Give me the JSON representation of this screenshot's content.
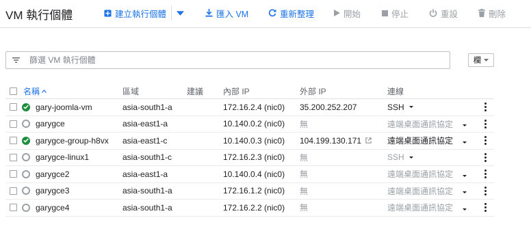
{
  "header": {
    "title": "VM 執行個體",
    "create_label": "建立執行個體",
    "import_label": "匯入 VM",
    "refresh_label": "重新整理",
    "start_label": "開始",
    "stop_label": "停止",
    "reset_label": "重設",
    "delete_label": "刪除"
  },
  "filter": {
    "placeholder": "篩選 VM 執行個體"
  },
  "columns_button": {
    "label": "欄"
  },
  "table": {
    "headers": {
      "name": "名稱",
      "zone": "區域",
      "recommendation": "建議",
      "internal_ip": "內部 IP",
      "external_ip": "外部 IP",
      "connect": "連線"
    },
    "rows": [
      {
        "name": "gary-joomla-vm",
        "status": "running",
        "zone": "asia-south1-a",
        "internal_ip": "172.16.2.4 (nic0)",
        "external_ip": "35.200.252.207",
        "connect": "SSH"
      },
      {
        "name": "garygce",
        "status": "stopped",
        "zone": "asia-east1-a",
        "internal_ip": "10.140.0.2 (nic0)",
        "external_ip": "無",
        "connect": "遠端桌面通訊協定"
      },
      {
        "name": "garygce-group-h8vx",
        "status": "running",
        "zone": "asia-east1-c",
        "internal_ip": "10.140.0.3 (nic0)",
        "external_ip": "104.199.130.171",
        "connect": "遠端桌面通訊協定"
      },
      {
        "name": "garygce-linux1",
        "status": "stopped",
        "zone": "asia-south1-c",
        "internal_ip": "172.16.2.3 (nic0)",
        "external_ip": "無",
        "connect": "SSH"
      },
      {
        "name": "garygce2",
        "status": "stopped",
        "zone": "asia-east1-a",
        "internal_ip": "10.140.0.4 (nic0)",
        "external_ip": "無",
        "connect": "遠端桌面通訊協定"
      },
      {
        "name": "garygce3",
        "status": "stopped",
        "zone": "asia-south1-a",
        "internal_ip": "172.16.1.2 (nic0)",
        "external_ip": "無",
        "connect": "遠端桌面通訊協定"
      },
      {
        "name": "garygce4",
        "status": "stopped",
        "zone": "asia-south1-a",
        "internal_ip": "172.16.2.2 (nic0)",
        "external_ip": "無",
        "connect": "遠端桌面通訊協定"
      }
    ]
  },
  "colors": {
    "accent": "#1a73e8",
    "running": "#1e8e3e",
    "disabled": "#9aa0a6"
  }
}
